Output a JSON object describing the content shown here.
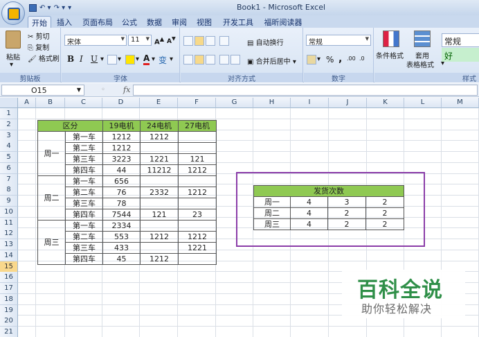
{
  "window": {
    "title": "Book1 - Microsoft Excel"
  },
  "qat": {
    "save_icon": "save-icon",
    "undo": "↶ ▾",
    "redo": "↷ ▾",
    "customize": "▾"
  },
  "tabs": [
    "开始",
    "插入",
    "页面布局",
    "公式",
    "数据",
    "审阅",
    "视图",
    "开发工具",
    "福昕阅读器"
  ],
  "ribbon": {
    "clipboard": {
      "paste": "粘贴",
      "cut": "剪切",
      "copy": "复制",
      "format_painter": "格式刷",
      "label": "剪贴板"
    },
    "font": {
      "name": "宋体",
      "size": "11",
      "bold": "B",
      "italic": "I",
      "underline": "U",
      "label": "字体"
    },
    "alignment": {
      "wrap": "自动换行",
      "merge": "合并后居中",
      "label": "对齐方式"
    },
    "number": {
      "format": "常规",
      "percent": "%",
      "comma": ",",
      "label": "数字"
    },
    "styles": {
      "conditional": "条件格式",
      "table_format": "套用",
      "table_format2": "表格格式",
      "normal": "常规",
      "good": "好",
      "label": "样式"
    }
  },
  "formula_bar": {
    "name_box": "O15",
    "fx": "fx",
    "value": ""
  },
  "columns": [
    "A",
    "B",
    "C",
    "D",
    "E",
    "F",
    "G",
    "H",
    "I",
    "J",
    "K",
    "L",
    "M"
  ],
  "rows": [
    "1",
    "2",
    "3",
    "4",
    "5",
    "6",
    "7",
    "8",
    "9",
    "10",
    "11",
    "12",
    "13",
    "14",
    "15",
    "16",
    "17",
    "18",
    "19",
    "20",
    "21"
  ],
  "table1": {
    "header": [
      "区分",
      "19电机",
      "24电机",
      "27电机"
    ],
    "groups": [
      {
        "day": "周一",
        "rows": [
          [
            "第一车",
            "1212",
            "1212",
            ""
          ],
          [
            "第二车",
            "1212",
            "",
            ""
          ],
          [
            "第三车",
            "3223",
            "1221",
            "121"
          ],
          [
            "第四车",
            "44",
            "11212",
            "1212"
          ]
        ]
      },
      {
        "day": "周二",
        "rows": [
          [
            "第一车",
            "656",
            "",
            ""
          ],
          [
            "第二车",
            "76",
            "2332",
            "1212"
          ],
          [
            "第三车",
            "78",
            "",
            ""
          ],
          [
            "第四车",
            "7544",
            "121",
            "23"
          ]
        ]
      },
      {
        "day": "周三",
        "rows": [
          [
            "第一车",
            "2334",
            "",
            ""
          ],
          [
            "第二车",
            "553",
            "1212",
            "1212"
          ],
          [
            "第三车",
            "433",
            "",
            "1221"
          ],
          [
            "第四车",
            "45",
            "1212",
            ""
          ]
        ]
      }
    ]
  },
  "table2": {
    "title": "发货次数",
    "rows": [
      [
        "周一",
        "4",
        "3",
        "2"
      ],
      [
        "周二",
        "4",
        "2",
        "2"
      ],
      [
        "周三",
        "4",
        "2",
        "2"
      ]
    ]
  },
  "watermark": {
    "title": "百科全说",
    "subtitle": "助你轻松解决"
  },
  "colors": {
    "header_green": "#8fc952",
    "highlight_purple": "#8a3ca8",
    "selected_row": "#f9d88c"
  }
}
